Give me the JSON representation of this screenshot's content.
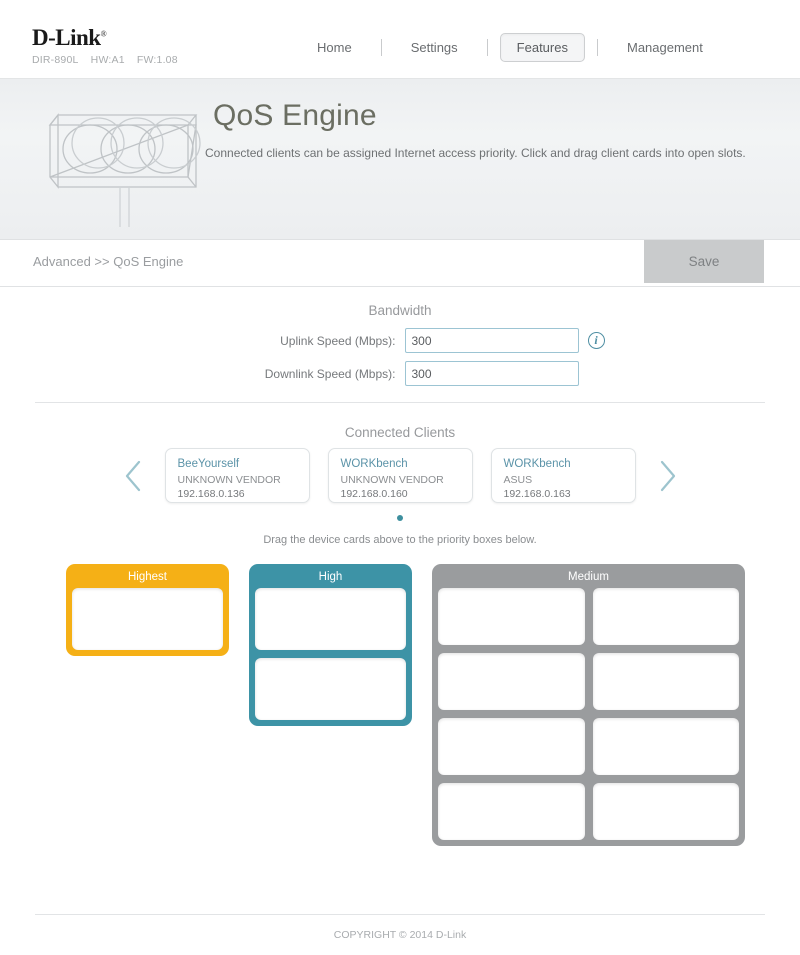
{
  "brand": {
    "name": "D-Link",
    "trademark": "®",
    "model": "DIR-890L",
    "hardware": "HW:A1",
    "firmware": "FW:1.08"
  },
  "nav": {
    "items": [
      {
        "label": "Home",
        "active": false
      },
      {
        "label": "Settings",
        "active": false
      },
      {
        "label": "Features",
        "active": true
      },
      {
        "label": "Management",
        "active": false
      }
    ]
  },
  "hero": {
    "title": "QoS Engine",
    "description": "Connected clients can be assigned Internet access priority. Click and drag client cards into open slots.",
    "art": "traffic-light-illustration"
  },
  "breadcrumb": {
    "text": "Advanced >> QoS Engine"
  },
  "toolbar": {
    "save_label": "Save"
  },
  "bandwidth": {
    "title": "Bandwidth",
    "uplink": {
      "label": "Uplink Speed (Mbps):",
      "value": "300",
      "placeholder": ""
    },
    "downlink": {
      "label": "Downlink Speed (Mbps):",
      "value": "300",
      "placeholder": ""
    },
    "info_icon": "info-icon"
  },
  "clients": {
    "title": "Connected Clients",
    "prev_icon": "chevron-left-icon",
    "next_icon": "chevron-right-icon",
    "cards": [
      {
        "name": "BeeYourself",
        "vendor": "UNKNOWN VENDOR",
        "ip": "192.168.0.136"
      },
      {
        "name": "WORKbench",
        "vendor": "UNKNOWN VENDOR",
        "ip": "192.168.0.160"
      },
      {
        "name": "WORKbench",
        "vendor": "ASUS",
        "ip": "192.168.0.163"
      }
    ],
    "page_count": 1,
    "active_page": 1,
    "drag_hint": "Drag the device cards above to the priority boxes below."
  },
  "priority": {
    "boxes": [
      {
        "label": "Highest",
        "color": "#f5b016",
        "slots": 1
      },
      {
        "label": "High",
        "color": "#3d93a6",
        "slots": 2
      },
      {
        "label": "Medium",
        "color": "#9a9c9e",
        "slots": 8
      }
    ]
  },
  "footer": {
    "copyright": "COPYRIGHT © 2014 D-Link"
  },
  "colors": {
    "accent_teal": "#3d93a6",
    "accent_orange": "#f5b016",
    "accent_gray": "#9a9c9e",
    "link_teal": "#5b93a8"
  }
}
